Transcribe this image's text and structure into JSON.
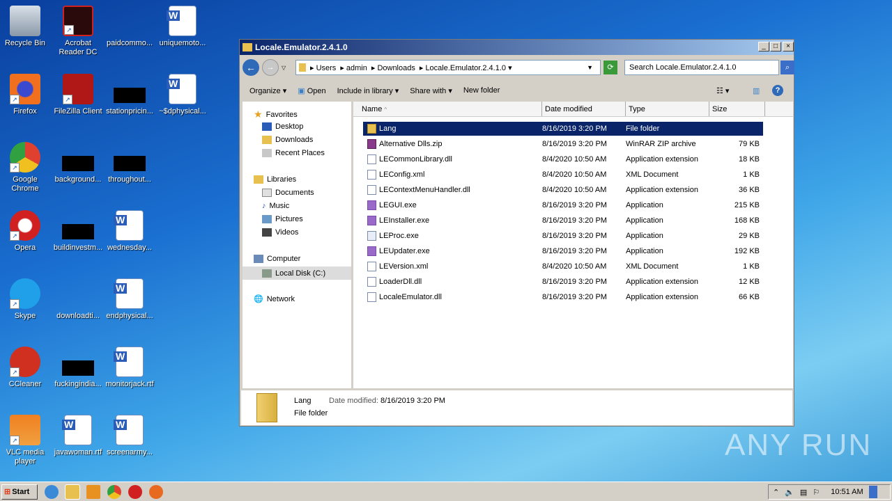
{
  "desktop": {
    "icons": [
      {
        "label": "Recycle Bin",
        "kind": "recycle"
      },
      {
        "label": "Acrobat Reader DC",
        "kind": "acrobat"
      },
      {
        "label": "paidcommo...",
        "kind": "blank"
      },
      {
        "label": "uniquemoto...",
        "kind": "word"
      },
      {
        "label": "Firefox",
        "kind": "firefox"
      },
      {
        "label": "FileZilla Client",
        "kind": "filezilla"
      },
      {
        "label": "stationpricin...",
        "kind": "black"
      },
      {
        "label": "~$dphysical...",
        "kind": "word"
      },
      {
        "label": "Google Chrome",
        "kind": "chrome"
      },
      {
        "label": "background...",
        "kind": "black"
      },
      {
        "label": "throughout...",
        "kind": "black"
      },
      {
        "label": "Opera",
        "kind": "opera"
      },
      {
        "label": "buildinvestm...",
        "kind": "black"
      },
      {
        "label": "wednesday...",
        "kind": "word"
      },
      {
        "label": "Skype",
        "kind": "skype"
      },
      {
        "label": "downloadti...",
        "kind": "blank"
      },
      {
        "label": "endphysical...",
        "kind": "word"
      },
      {
        "label": "CCleaner",
        "kind": "ccleaner"
      },
      {
        "label": "fuckingindia...",
        "kind": "black"
      },
      {
        "label": "monitorjack.rtf",
        "kind": "word"
      },
      {
        "label": "VLC media player",
        "kind": "vlc"
      },
      {
        "label": "javawoman.rtf",
        "kind": "word"
      },
      {
        "label": "screenarmy...",
        "kind": "word"
      }
    ]
  },
  "window": {
    "title": "Locale.Emulator.2.4.1.0",
    "breadcrumb": [
      "Users",
      "admin",
      "Downloads",
      "Locale.Emulator.2.4.1.0"
    ],
    "search_placeholder": "Search Locale.Emulator.2.4.1.0",
    "toolbar": {
      "organize": "Organize",
      "open": "Open",
      "include": "Include in library",
      "share": "Share with",
      "new_folder": "New folder"
    },
    "nav": {
      "favorites": "Favorites",
      "desktop": "Desktop",
      "downloads": "Downloads",
      "recent": "Recent Places",
      "libraries": "Libraries",
      "documents": "Documents",
      "music": "Music",
      "pictures": "Pictures",
      "videos": "Videos",
      "computer": "Computer",
      "local_disk": "Local Disk (C:)",
      "network": "Network"
    },
    "columns": {
      "name": "Name",
      "date": "Date modified",
      "type": "Type",
      "size": "Size"
    },
    "files": [
      {
        "name": "Lang",
        "date": "8/16/2019 3:20 PM",
        "type": "File folder",
        "size": "",
        "icon": "folder"
      },
      {
        "name": "Alternative Dlls.zip",
        "date": "8/16/2019 3:20 PM",
        "type": "WinRAR ZIP archive",
        "size": "79 KB",
        "icon": "zip"
      },
      {
        "name": "LECommonLibrary.dll",
        "date": "8/4/2020 10:50 AM",
        "type": "Application extension",
        "size": "18 KB",
        "icon": "dll"
      },
      {
        "name": "LEConfig.xml",
        "date": "8/4/2020 10:50 AM",
        "type": "XML Document",
        "size": "1 KB",
        "icon": "xml"
      },
      {
        "name": "LEContextMenuHandler.dll",
        "date": "8/4/2020 10:50 AM",
        "type": "Application extension",
        "size": "36 KB",
        "icon": "dll"
      },
      {
        "name": "LEGUI.exe",
        "date": "8/16/2019 3:20 PM",
        "type": "Application",
        "size": "215 KB",
        "icon": "le"
      },
      {
        "name": "LEInstaller.exe",
        "date": "8/16/2019 3:20 PM",
        "type": "Application",
        "size": "168 KB",
        "icon": "le"
      },
      {
        "name": "LEProc.exe",
        "date": "8/16/2019 3:20 PM",
        "type": "Application",
        "size": "29 KB",
        "icon": "exe"
      },
      {
        "name": "LEUpdater.exe",
        "date": "8/16/2019 3:20 PM",
        "type": "Application",
        "size": "192 KB",
        "icon": "le"
      },
      {
        "name": "LEVersion.xml",
        "date": "8/4/2020 10:50 AM",
        "type": "XML Document",
        "size": "1 KB",
        "icon": "xml"
      },
      {
        "name": "LoaderDll.dll",
        "date": "8/16/2019 3:20 PM",
        "type": "Application extension",
        "size": "12 KB",
        "icon": "dll"
      },
      {
        "name": "LocaleEmulator.dll",
        "date": "8/16/2019 3:20 PM",
        "type": "Application extension",
        "size": "66 KB",
        "icon": "dll"
      }
    ],
    "details": {
      "name": "Lang",
      "date_label": "Date modified:",
      "date": "8/16/2019 3:20 PM",
      "type": "File folder"
    }
  },
  "taskbar": {
    "start": "Start",
    "clock": "10:51 AM"
  },
  "watermark": "ANY RUN"
}
